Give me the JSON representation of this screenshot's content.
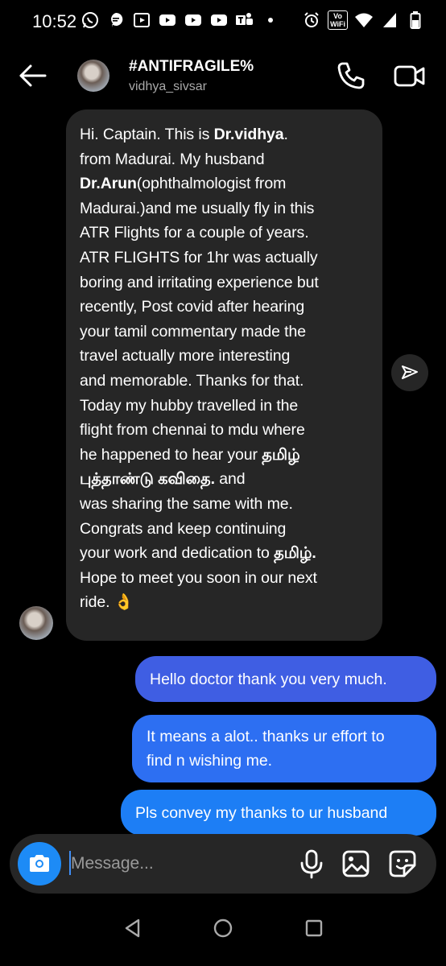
{
  "status_bar": {
    "time": "10:52",
    "wifi_badge": "Vo\nWiFi"
  },
  "header": {
    "title": "#ANTIFRAGILE%",
    "username": "vidhya_sivsar"
  },
  "incoming_message": {
    "html_segments": [
      {
        "t": "Hi. Captain. This is ",
        "b": false
      },
      {
        "t": "Dr.vidhya",
        "b": true
      },
      {
        "t": ".\nfrom Madurai. My husband\n",
        "b": false
      },
      {
        "t": "Dr.Arun",
        "b": true
      },
      {
        "t": "(ophthalmologist from\nMadurai.)and me usually fly in this\nATR Flights for a couple of years.\nATR FLIGHTS for 1hr was actually\nboring and irritating experience but\nrecently, Post covid after hearing\nyour tamil commentary made the\ntravel actually more interesting\nand memorable. Thanks for that.\nToday my hubby travelled in the\nflight from chennai to mdu where\nhe happened to hear your ",
        "b": false
      },
      {
        "t": "தமிழ்\nபுத்தாண்டு கவிதை.",
        "b": true
      },
      {
        "t": " and\nwas sharing the same with me.\nCongrats and keep  continuing\nyour work and dedication to ",
        "b": false
      },
      {
        "t": "தமிழ்.",
        "b": true
      },
      {
        "t": "\nHope to meet you soon in our next\nride. 👌",
        "b": false
      }
    ]
  },
  "outgoing_messages": [
    "Hello doctor thank you very much.",
    "It means a alot.. thanks ur effort to\nfind n wishing me.",
    "Pls convey my thanks to ur husband"
  ],
  "composer": {
    "placeholder": "Message..."
  },
  "colors": {
    "background": "#000000",
    "incoming_bubble": "#262626",
    "outgoing_1": "#3f5ee3",
    "outgoing_2": "#2d6ff2",
    "outgoing_3": "#1d7ef5",
    "camera_button": "#1d8bf6"
  },
  "icons": {
    "header": [
      "back-arrow-icon",
      "phone-icon",
      "video-camera-icon"
    ],
    "composer": [
      "camera-icon",
      "microphone-icon",
      "gallery-icon",
      "sticker-icon"
    ],
    "nav": [
      "nav-back-icon",
      "nav-home-icon",
      "nav-recents-icon"
    ]
  }
}
